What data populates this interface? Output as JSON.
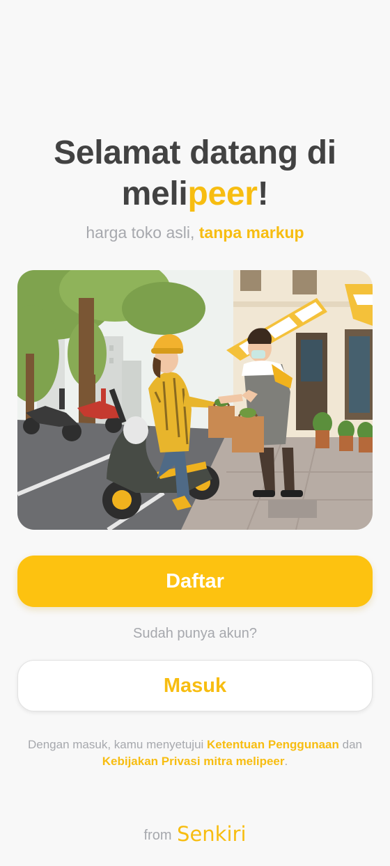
{
  "welcome": {
    "title_line1": "Selamat datang di",
    "title_prefix": "meli",
    "title_brand": "peer",
    "title_suffix": "!"
  },
  "tagline": {
    "text": "harga toko asli,",
    "highlight": "tanpa markup"
  },
  "hero": {
    "description": "illustration"
  },
  "buttons": {
    "register_label": "Daftar",
    "login_label": "Masuk"
  },
  "login_prompt": "Sudah punya akun?",
  "terms": {
    "prefix": "Dengan masuk, kamu menyetujui",
    "terms_link": "Ketentuan Penggunaan",
    "conjunction": "dan",
    "privacy_link": "Kebijakan Privasi mitra melipeer",
    "suffix": "."
  },
  "footer": {
    "from_label": "from",
    "brand": "Senkiri"
  },
  "colors": {
    "accent": "#f7bd11",
    "primary_button": "#fdc210",
    "title_text": "#424242",
    "muted_text": "#a6a8ad",
    "background": "#f8f8f8"
  }
}
